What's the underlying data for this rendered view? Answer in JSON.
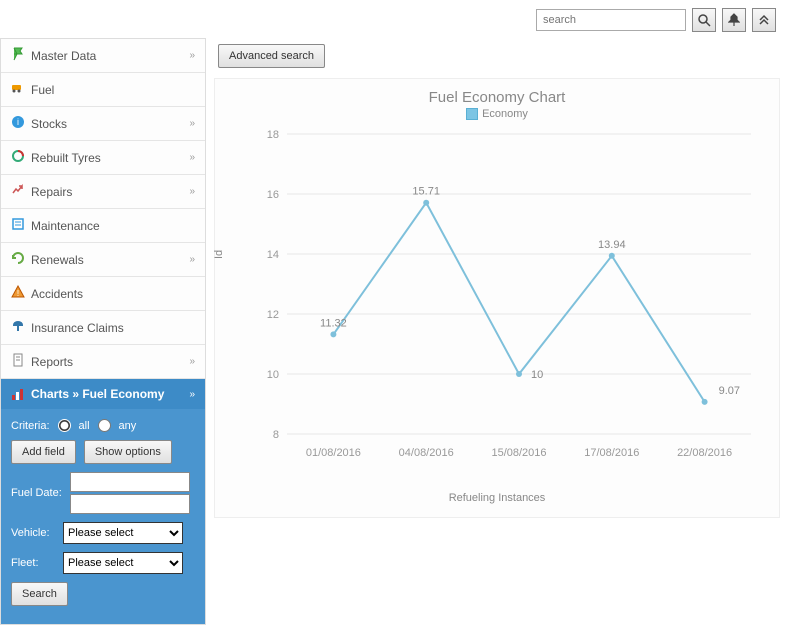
{
  "topbar": {
    "search_placeholder": "search"
  },
  "sidebar": {
    "items": [
      {
        "label": "Master Data",
        "expandable": true
      },
      {
        "label": "Fuel",
        "expandable": false
      },
      {
        "label": "Stocks",
        "expandable": true
      },
      {
        "label": "Rebuilt Tyres",
        "expandable": true
      },
      {
        "label": "Repairs",
        "expandable": true
      },
      {
        "label": "Maintenance",
        "expandable": false
      },
      {
        "label": "Renewals",
        "expandable": true
      },
      {
        "label": "Accidents",
        "expandable": false
      },
      {
        "label": "Insurance Claims",
        "expandable": false
      },
      {
        "label": "Reports",
        "expandable": true
      }
    ],
    "active": {
      "crumb": "Charts » Fuel Economy"
    }
  },
  "filters": {
    "criteria_label": "Criteria:",
    "all": "all",
    "any": "any",
    "add_field": "Add field",
    "show_options": "Show options",
    "fuel_date": "Fuel Date:",
    "vehicle": "Vehicle:",
    "fleet": "Fleet:",
    "please_select": "Please select",
    "search": "Search"
  },
  "buttons": {
    "advanced_search": "Advanced search"
  },
  "chart_data": {
    "type": "line",
    "title": "Fuel Economy Chart",
    "legend": "Economy",
    "ylabel": "Id",
    "xlabel": "Refueling Instances",
    "ylim": [
      8,
      18
    ],
    "categories": [
      "01/08/2016",
      "04/08/2016",
      "15/08/2016",
      "17/08/2016",
      "22/08/2016"
    ],
    "values": [
      11.32,
      15.71,
      10,
      13.94,
      9.07
    ]
  }
}
